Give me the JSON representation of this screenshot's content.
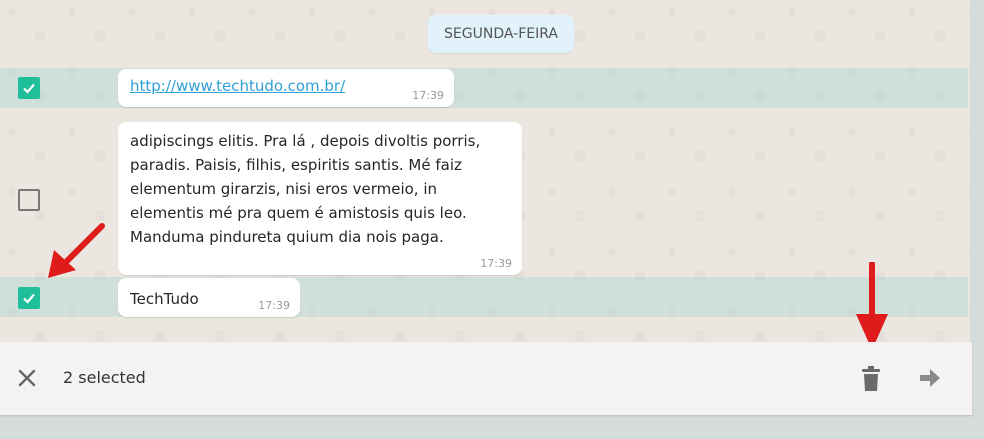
{
  "date_separator": "SEGUNDA-FEIRA",
  "messages": [
    {
      "text": "http://www.techtudo.com.br/",
      "time": "17:39",
      "selected": true,
      "is_link": true
    },
    {
      "text": "adipiscings elitis. Pra lá , depois divoltis porris, paradis. Paisis, filhis, espiritis santis. Mé faiz elementum girarzis, nisi eros vermeio, in elementis mé pra quem é amistosis quis leo. Manduma pindureta quium dia nois paga.",
      "time": "17:39",
      "selected": false,
      "is_link": false
    },
    {
      "text": "TechTudo",
      "time": "17:39",
      "selected": true,
      "is_link": false
    }
  ],
  "selection_bar": {
    "count_label": "2 selected",
    "close_icon": "close-icon",
    "delete_icon": "trash-icon",
    "forward_icon": "forward-arrow-icon"
  },
  "annotation_color": "#e01b1b",
  "accent_color": "#1fbf9b"
}
